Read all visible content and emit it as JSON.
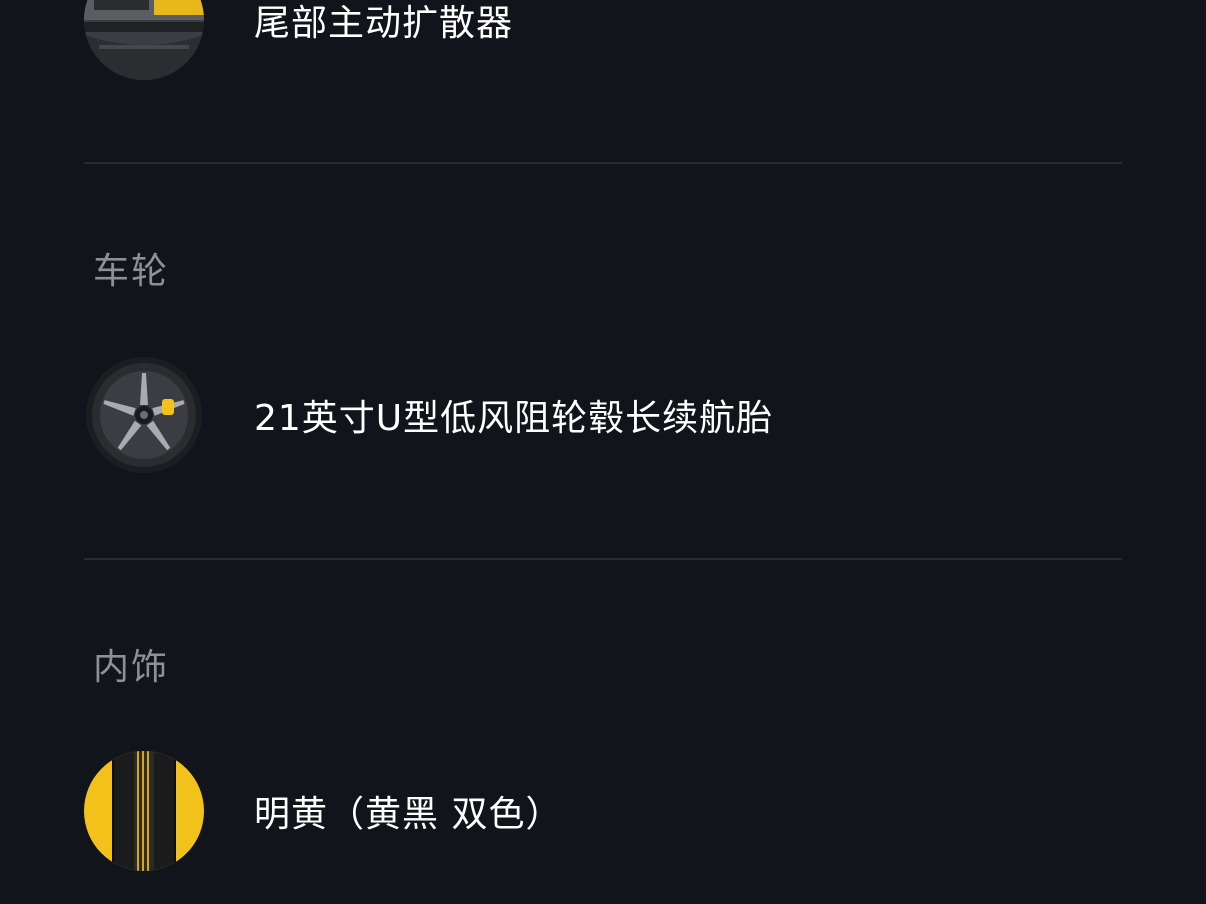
{
  "sections": [
    {
      "title": "",
      "items": [
        {
          "label": "尾部主动扩散器",
          "icon": "rear-diffuser-thumbnail"
        }
      ]
    },
    {
      "title": "车轮",
      "items": [
        {
          "label": "21英寸U型低风阻轮毂长续航胎",
          "icon": "wheel-thumbnail"
        }
      ]
    },
    {
      "title": "内饰",
      "items": [
        {
          "label": "明黄（黄黑 双色）",
          "icon": "interior-swatch-thumbnail"
        }
      ]
    }
  ],
  "colors": {
    "background": "#11141a",
    "divider": "#262a31",
    "section_title": "#8d9096",
    "item_text": "#ffffff",
    "accent_yellow": "#f2c21b"
  }
}
